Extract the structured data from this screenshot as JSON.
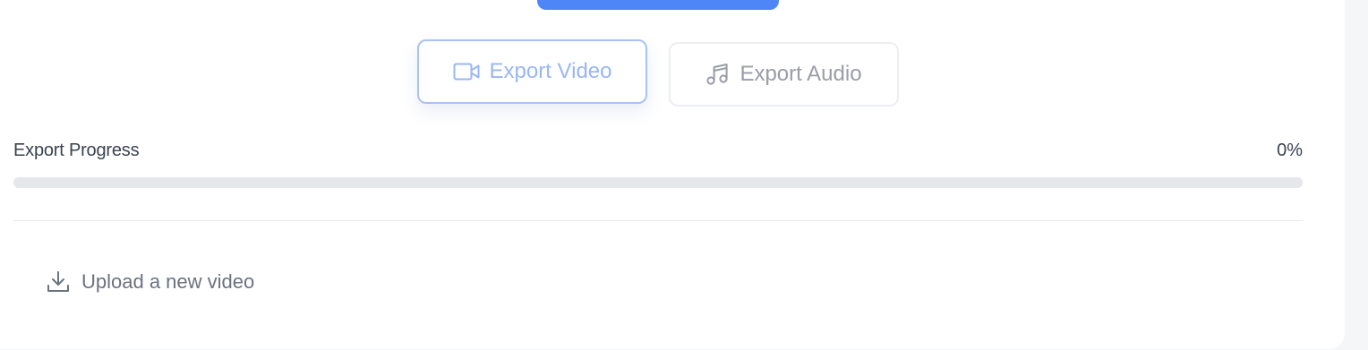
{
  "export": {
    "video_label": "Export Video",
    "audio_label": "Export Audio",
    "video_icon": "video-camera-icon",
    "audio_icon": "music-note-icon"
  },
  "progress": {
    "label": "Export Progress",
    "value_text": "0%",
    "value_fraction": 0
  },
  "upload": {
    "label": "Upload a new video",
    "icon": "download-icon"
  },
  "colors": {
    "accent": "#4f86f7",
    "video_border": "#a9c3f4",
    "muted_text": "#9a9ca7",
    "progress_track": "#e5e7eb"
  }
}
